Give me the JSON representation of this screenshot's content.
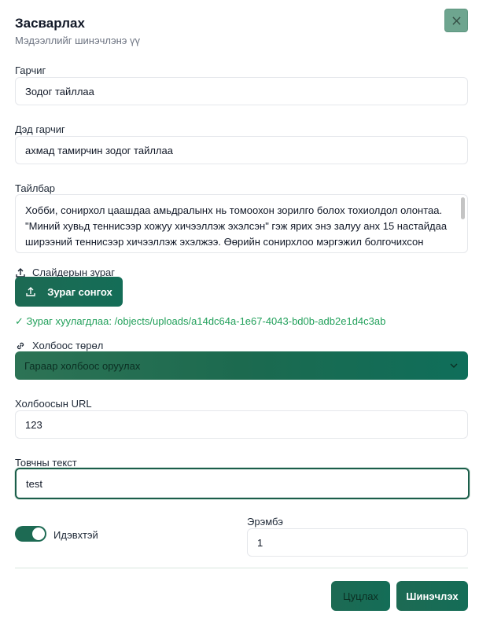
{
  "dialog": {
    "title": "Засварлах",
    "subtitle": "Мэдээллийг шинэчлэнэ үү",
    "close_icon": "close-icon"
  },
  "fields": {
    "title_label": "Гарчиг",
    "title_value": "Зодог тайллаа",
    "subtitle_label": "Дэд гарчиг",
    "subtitle_value": "ахмад тамирчин зодог тайллаа",
    "description_label": "Тайлбар",
    "description_value": "Хобби, сонирхол цаашдаа амьдралынх нь томоохон зорилго болох тохиолдол олонтаа. \"Миний хувьд теннисээр хожуу хичээллэж эхэлсэн\" гэж ярих энэ залуу анх 15 настайдаа ширээний теннисээр хичээллэж эхэлжээ. Өөрийн сонирхлоо мэргэжил болгочихсон тэрбээр олон спортын зээ мастер цолтой. Гэлтгэлэг нийт темнисчин хамгааж",
    "slider_image_label": "Слайдерын зураг",
    "upload_button": "Зураг сонгох",
    "uploaded_text": "✓ Зураг хуулагдлаа: /objects/uploads/a14dc64a-1e67-4043-bd0b-adb2e1d4c3ab",
    "link_type_label": "Холбоос төрөл",
    "link_type_value": "Гараар холбоос оруулах",
    "url_label": "Холбоосын URL",
    "url_value": "123",
    "button_text_label": "Товчны текст",
    "button_text_value": "test",
    "active_label": "Идэвхтэй",
    "active": true,
    "order_label": "Эрэмбэ",
    "order_value": "1"
  },
  "actions": {
    "cancel": "Цуцлах",
    "update": "Шинэчлэх"
  },
  "colors": {
    "accent": "#1d6a53",
    "success": "#22a05b"
  }
}
